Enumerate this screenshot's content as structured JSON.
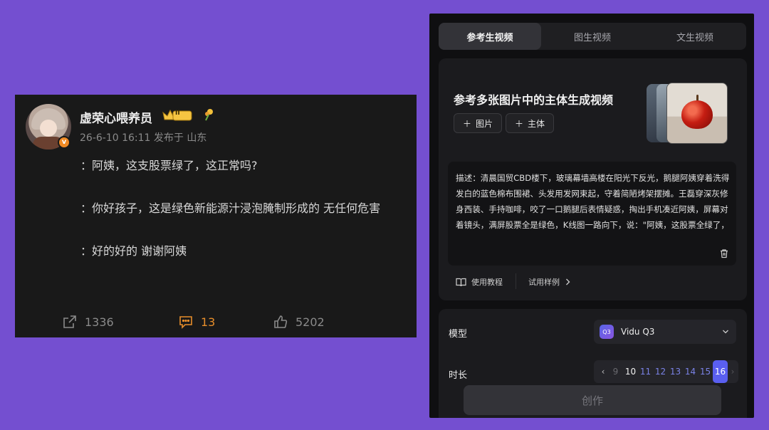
{
  "post": {
    "username": "虚荣心喂养员",
    "rank_badge": "II",
    "meta": "26-6-10 16:11 发布于 山东",
    "lines": [
      "：阿姨，这支股票绿了，这正常吗?",
      "：你好孩子，这是绿色新能源汁浸泡腌制形成的 无任何危害",
      "：好的好的 谢谢阿姨"
    ],
    "share_count": "1336",
    "comment_count": "13",
    "like_count": "5202",
    "colors": {
      "comment_accent": "#e78e2b",
      "verified": "#f08a24"
    }
  },
  "vidu": {
    "tabs": [
      "参考生视频",
      "图生视频",
      "文生视频"
    ],
    "active_tab": 0,
    "ref_title": "参考多张图片中的主体生成视频",
    "chip_image": "图片",
    "chip_subject": "主体",
    "description": "描述：清晨国贸CBD楼下，玻璃幕墙高楼在阳光下反光，鹅腿阿姨穿着洗得发白的蓝色棉布围裙、头发用发网束起，守着简陋烤架摆摊。王磊穿深灰修身西装、手持咖啡，咬了一口鹅腿后表情疑惑，掏出手机凑近阿姨，屏幕对着镜头，满屏股票全是绿色，K线图一路向下，说：\"阿姨，这股票全绿了，这正常吗?\"阿姨头也不抬，继续翻烤鹅",
    "tutorial_label": "使用教程",
    "try_example_label": "试用样例",
    "model_label": "模型",
    "model_logo": "Q3",
    "model_name": "Vidu Q3",
    "duration_label": "时长",
    "durations": [
      "9",
      "10",
      "11",
      "12",
      "13",
      "14",
      "15",
      "16"
    ],
    "selected_duration": "16",
    "create_label": "创作",
    "colors": {
      "accent": "#5a5ff0"
    }
  }
}
